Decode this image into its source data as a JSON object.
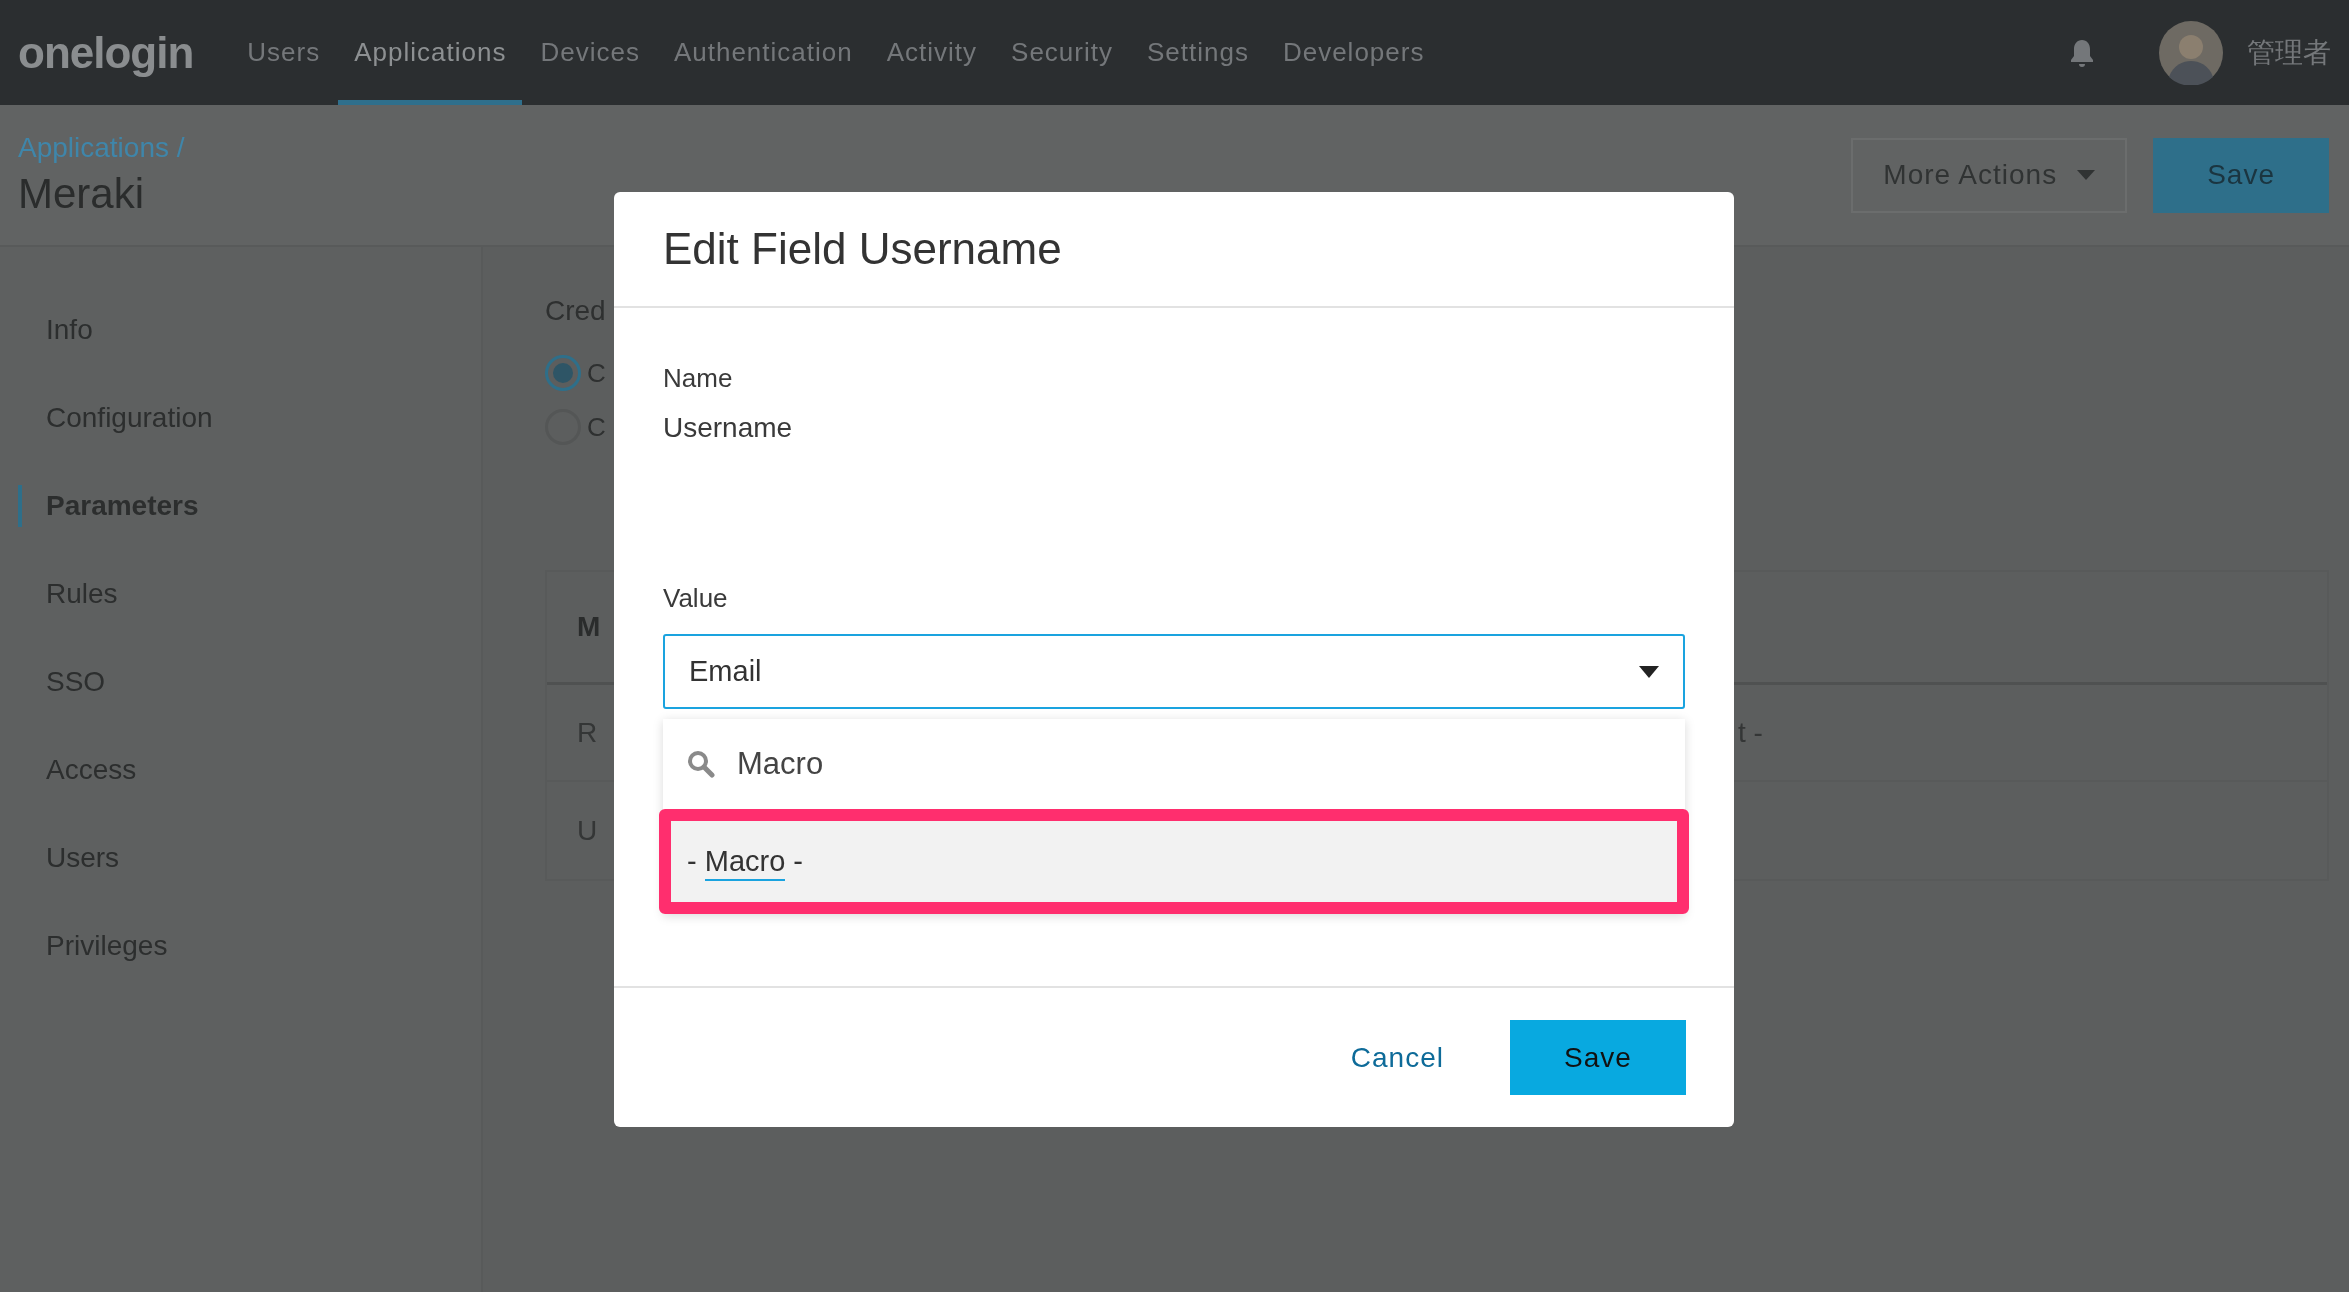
{
  "app_bar": {
    "logo": "onelogin",
    "nav": [
      {
        "label": "Users",
        "selected": false
      },
      {
        "label": "Applications",
        "selected": true
      },
      {
        "label": "Devices",
        "selected": false
      },
      {
        "label": "Authentication",
        "selected": false
      },
      {
        "label": "Activity",
        "selected": false
      },
      {
        "label": "Security",
        "selected": false
      },
      {
        "label": "Settings",
        "selected": false
      },
      {
        "label": "Developers",
        "selected": false
      }
    ],
    "user": {
      "name": "管理者"
    }
  },
  "page_header": {
    "breadcrumb": "Applications /",
    "title": "Meraki",
    "actions": [
      {
        "label": "More Actions",
        "kind": "menu"
      },
      {
        "label": "Save",
        "kind": "primary"
      }
    ]
  },
  "sidebar": {
    "items": [
      {
        "label": "Info",
        "selected": false
      },
      {
        "label": "Configuration",
        "selected": false
      },
      {
        "label": "Parameters",
        "selected": true
      },
      {
        "label": "Rules",
        "selected": false
      },
      {
        "label": "SSO",
        "selected": false
      },
      {
        "label": "Access",
        "selected": false
      },
      {
        "label": "Users",
        "selected": false
      },
      {
        "label": "Privileges",
        "selected": false
      }
    ]
  },
  "content": {
    "section_label": "Cred",
    "radios": [
      {
        "label": "C",
        "selected": true
      },
      {
        "label": "C",
        "selected": false
      }
    ],
    "table": {
      "header": "M",
      "rows": [
        {
          "column_1": "R",
          "column_2": "t -"
        },
        {
          "column_1": "U"
        }
      ]
    }
  },
  "dialog": {
    "title": "Edit Field Username",
    "name_field": {
      "label": "Name",
      "value": "Username"
    },
    "value_field": {
      "label": "Value",
      "value": "Email",
      "expanded": true,
      "search": "Macro",
      "options": [
        {
          "prefix": "- ",
          "match": "Macro",
          "suffix": " -",
          "highlighted": true
        }
      ]
    },
    "buttons": [
      {
        "label": "Cancel",
        "kind": "link"
      },
      {
        "label": "Save",
        "kind": "primary"
      }
    ]
  }
}
